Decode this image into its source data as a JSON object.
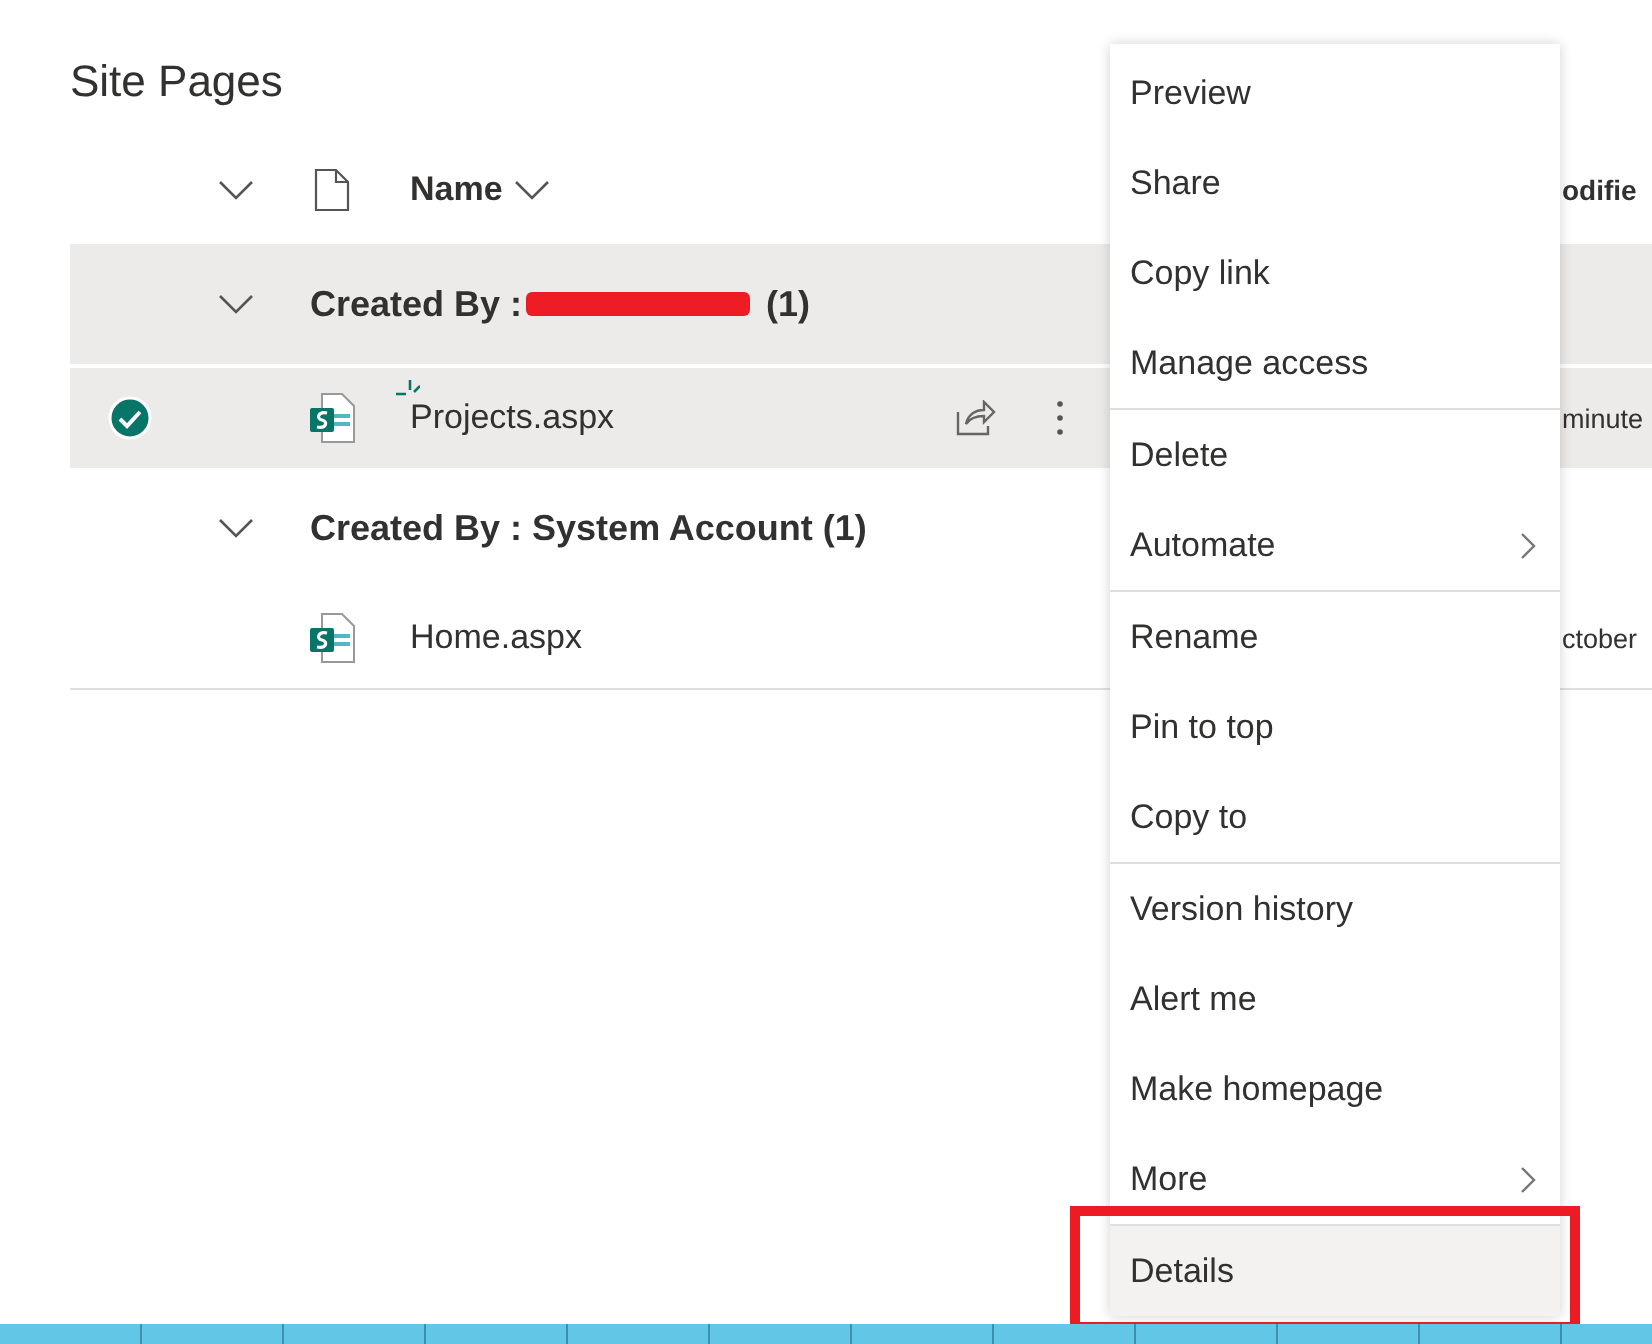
{
  "title": "Site Pages",
  "header": {
    "name": "Name",
    "modified": "odifie"
  },
  "groups": [
    {
      "label": "Created By :",
      "redacted": true,
      "suffix": "(1)",
      "selected": true,
      "expanded": true,
      "files": [
        {
          "name": "Projects.aspx",
          "modified": "minute",
          "selected": true,
          "is_new": true
        }
      ]
    },
    {
      "label": "Created By : System Account (1)",
      "redacted": false,
      "selected": false,
      "expanded": true,
      "files": [
        {
          "name": "Home.aspx",
          "modified": "ctober",
          "selected": false,
          "is_new": false
        }
      ]
    }
  ],
  "context_menu": {
    "sections": [
      [
        {
          "label": "Preview",
          "has_submenu": false,
          "selected": false
        },
        {
          "label": "Share",
          "has_submenu": false,
          "selected": false
        },
        {
          "label": "Copy link",
          "has_submenu": false,
          "selected": false
        },
        {
          "label": "Manage access",
          "has_submenu": false,
          "selected": false
        }
      ],
      [
        {
          "label": "Delete",
          "has_submenu": false,
          "selected": false
        },
        {
          "label": "Automate",
          "has_submenu": true,
          "selected": false
        }
      ],
      [
        {
          "label": "Rename",
          "has_submenu": false,
          "selected": false
        },
        {
          "label": "Pin to top",
          "has_submenu": false,
          "selected": false
        },
        {
          "label": "Copy to",
          "has_submenu": false,
          "selected": false
        }
      ],
      [
        {
          "label": "Version history",
          "has_submenu": false,
          "selected": false
        },
        {
          "label": "Alert me",
          "has_submenu": false,
          "selected": false
        },
        {
          "label": "Make homepage",
          "has_submenu": false,
          "selected": false
        },
        {
          "label": "More",
          "has_submenu": true,
          "selected": false
        }
      ],
      [
        {
          "label": "Details",
          "has_submenu": false,
          "selected": true,
          "highlighted": true
        }
      ]
    ]
  }
}
